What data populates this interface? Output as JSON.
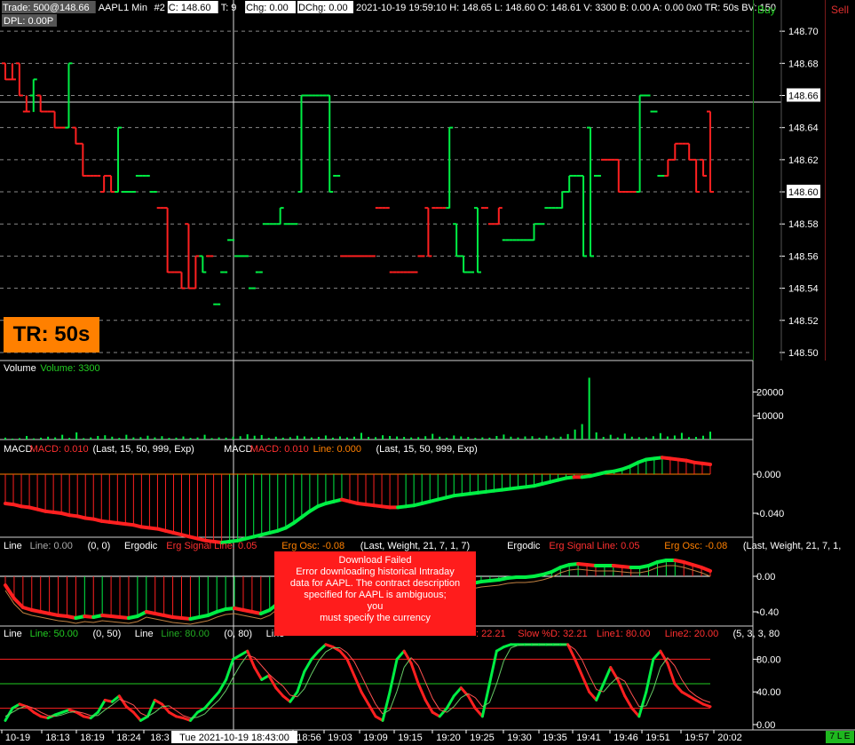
{
  "header": {
    "line1": [
      {
        "text": "Trade: 500@148.66",
        "color": "#ffffff",
        "bg": "#555555"
      },
      {
        "text": "AAPL",
        "color": "#ffffff",
        "bg": ""
      },
      {
        "text": "1 Min",
        "color": "#ffffff",
        "bg": ""
      },
      {
        "text": "#2",
        "color": "#ffffff",
        "bg": ""
      },
      {
        "text": "C: 148.60",
        "color": "#000000",
        "bg": "#ffffff"
      },
      {
        "text": "T: 9",
        "color": "#ffffff",
        "bg": ""
      },
      {
        "text": "Chg: 0.00",
        "color": "#000000",
        "bg": "#ffffff"
      },
      {
        "text": "DChg: 0.00",
        "color": "#000000",
        "bg": "#ffffff"
      },
      {
        "text": "2021-10-19 19:59:10 H: 148.65 L: 148.60 O: 148.61 V: 3300 B: 0.00 A: 0.00 0x0 TR: 50s BV: 150",
        "color": "#ffffff",
        "bg": ""
      }
    ],
    "line2": "DPL: 0.00P"
  },
  "buy_label": "Buy",
  "sell_label": "Sell",
  "tr_badge": "TR: 50s",
  "bottom_badge": "7 L E",
  "error": {
    "title": "Download Failed",
    "message": "Error downloading historical Intraday\ndata for AAPL.  The contract description\nspecified for AAPL is ambiguous;\nyou\nmust specify the currency"
  },
  "price_axis": [
    "148.70",
    "148.68",
    "148.66",
    "148.64",
    "148.62",
    "148.60",
    "148.58",
    "148.56",
    "148.54",
    "148.52",
    "148.50"
  ],
  "price_highlight": [
    "148.66",
    "148.60"
  ],
  "volume_axis": [
    "20000",
    "10000"
  ],
  "macd_axis": [
    "0.000",
    "-0.040"
  ],
  "ergodic_axis": [
    "0.00",
    "-0.40"
  ],
  "stoch_axis": [
    "80.00",
    "40.00",
    "0.00"
  ],
  "time_axis": {
    "labels": [
      "10-19",
      "18:13",
      "18:19",
      "18:24",
      "18:3",
      "18:56",
      "19:03",
      "19:09",
      "19:15",
      "19:20",
      "19:25",
      "19:30",
      "19:35",
      "19:41",
      "19:46",
      "19:51",
      "19:57",
      "20:02"
    ],
    "cursor_label": "Tue 2021-10-19  18:43:00"
  },
  "panels": {
    "volume": [
      {
        "text": "Volume",
        "color": "#ffffff"
      },
      {
        "text": "Volume: 3300",
        "color": "#22cc22"
      }
    ],
    "macd": [
      {
        "text": "MACD",
        "color": "#ffffff"
      },
      {
        "text": "MACD: 0.010",
        "color": "#ff3030"
      },
      {
        "text": "(Last, 15, 50, 999, Exp)",
        "color": "#ffffff"
      },
      {
        "text": "MACD",
        "color": "#ffffff"
      },
      {
        "text": "MACD: 0.010",
        "color": "#ff3030"
      },
      {
        "text": "Line: 0.000",
        "color": "#ff8000"
      },
      {
        "text": "(Last, 15, 50, 999, Exp)",
        "color": "#ffffff"
      }
    ],
    "ergodic": [
      {
        "text": "Line",
        "color": "#ffffff"
      },
      {
        "text": "Line: 0.00",
        "color": "#aaaaaa"
      },
      {
        "text": "(0, 0)",
        "color": "#ffffff"
      },
      {
        "text": "Ergodic",
        "color": "#ffffff"
      },
      {
        "text": "Erg Signal Line: 0.05",
        "color": "#ff3030"
      },
      {
        "text": "Erg Osc: -0.08",
        "color": "#ff8000"
      },
      {
        "text": "(Last, Weight, 21, 7, 1, 7)",
        "color": "#ffffff"
      },
      {
        "text": "Ergodic",
        "color": "#ffffff"
      },
      {
        "text": "Erg Signal Line: 0.05",
        "color": "#ff3030"
      },
      {
        "text": "Erg Osc: -0.08",
        "color": "#ff8000"
      },
      {
        "text": "(Last, Weight, 21, 7, 1,",
        "color": "#ffffff"
      }
    ],
    "stoch_left": [
      {
        "text": "Line",
        "color": "#ffffff"
      },
      {
        "text": "Line: 50.00",
        "color": "#22cc22"
      },
      {
        "text": "(0, 50)",
        "color": "#ffffff"
      },
      {
        "text": "Line",
        "color": "#ffffff"
      },
      {
        "text": "Line: 80.00",
        "color": "#22aa22"
      },
      {
        "text": "(0, 80)",
        "color": "#ffffff"
      },
      {
        "text": "Line",
        "color": "#ffffff"
      }
    ],
    "stoch_right": [
      {
        "text": ": 22.21",
        "color": "#ff3030"
      },
      {
        "text": "Slow %D: 32.21",
        "color": "#ff3030"
      },
      {
        "text": "Line1: 80.00",
        "color": "#ff3030"
      },
      {
        "text": "Line2: 20.00",
        "color": "#ff3030"
      },
      {
        "text": "(5, 3, 3, 80",
        "color": "#ffffff"
      }
    ]
  },
  "colors": {
    "up": "#00ee44",
    "down": "#ff2020",
    "grid": "#888888",
    "accent": "#ff8000"
  },
  "price_bars": [
    [
      148.68,
      148.68,
      148.68,
      148.67,
      0
    ],
    [
      148.67,
      148.67,
      148.68,
      148.67,
      0
    ],
    [
      148.68,
      148.68,
      148.66,
      148.66,
      0
    ],
    [
      148.65,
      148.65,
      148.66,
      148.65,
      0
    ],
    [
      148.66,
      148.65,
      148.67,
      148.67,
      1
    ],
    [
      148.66,
      148.66,
      148.65,
      148.65,
      0
    ],
    [
      148.65,
      148.65,
      148.65,
      148.65,
      0
    ],
    [
      148.65,
      148.64,
      148.65,
      148.64,
      0
    ],
    [
      148.64,
      148.64,
      148.64,
      148.64,
      0
    ],
    [
      148.64,
      148.64,
      148.68,
      148.68,
      1
    ],
    [
      148.64,
      148.64,
      148.63,
      148.63,
      0
    ],
    [
      148.63,
      148.63,
      148.61,
      148.61,
      0
    ],
    [
      148.61,
      148.61,
      148.61,
      148.61,
      0
    ],
    [
      148.61,
      148.61,
      148.61,
      148.61,
      0
    ],
    [
      148.6,
      148.6,
      148.61,
      148.61,
      0
    ],
    [
      148.61,
      148.61,
      148.6,
      148.6,
      0
    ],
    [
      148.6,
      148.6,
      148.64,
      148.64,
      1
    ],
    [
      148.6,
      148.6,
      148.6,
      148.6,
      1
    ],
    [
      148.6,
      148.6,
      148.6,
      148.6,
      1
    ],
    [
      148.61,
      148.61,
      148.61,
      148.61,
      1
    ],
    [
      148.61,
      148.61,
      148.61,
      148.61,
      1
    ],
    [
      148.6,
      148.6,
      148.6,
      148.6,
      1
    ],
    [
      148.59,
      148.59,
      148.59,
      148.59,
      0
    ],
    [
      148.59,
      148.59,
      148.55,
      148.55,
      0
    ],
    [
      148.55,
      148.55,
      148.55,
      148.55,
      0
    ],
    [
      148.55,
      148.55,
      148.54,
      148.54,
      0
    ],
    [
      148.58,
      148.58,
      148.54,
      148.54,
      0
    ],
    [
      148.54,
      148.54,
      148.56,
      148.56,
      0
    ],
    [
      148.56,
      148.56,
      148.55,
      148.55,
      1
    ],
    [
      148.56,
      148.56,
      148.56,
      148.56,
      0
    ],
    [
      148.53,
      148.53,
      148.53,
      148.53,
      1
    ],
    [
      148.55,
      148.55,
      148.55,
      148.55,
      1
    ],
    [
      148.57,
      148.57,
      148.57,
      148.57,
      1
    ],
    [
      148.56,
      148.56,
      148.56,
      148.56,
      1
    ],
    [
      148.56,
      148.56,
      148.56,
      148.56,
      1
    ],
    [
      148.54,
      148.54,
      148.54,
      148.54,
      1
    ],
    [
      148.55,
      148.55,
      148.55,
      148.55,
      1
    ],
    [
      148.58,
      148.58,
      148.58,
      148.58,
      1
    ],
    [
      148.58,
      148.58,
      148.58,
      148.58,
      1
    ],
    [
      148.58,
      148.58,
      148.59,
      148.59,
      1
    ],
    [
      148.58,
      148.58,
      148.58,
      148.58,
      1
    ],
    [
      148.58,
      148.58,
      148.58,
      148.58,
      1
    ],
    [
      148.6,
      148.6,
      148.66,
      148.66,
      1
    ],
    [
      148.66,
      148.66,
      148.66,
      148.66,
      1
    ],
    [
      148.66,
      148.66,
      148.66,
      148.66,
      1
    ],
    [
      148.66,
      148.66,
      148.66,
      148.66,
      1
    ],
    [
      148.66,
      148.66,
      148.6,
      148.6,
      1
    ],
    [
      148.61,
      148.61,
      148.61,
      148.61,
      1
    ],
    [
      148.56,
      148.56,
      148.56,
      148.56,
      0
    ],
    [
      148.56,
      148.56,
      148.56,
      148.56,
      0
    ],
    [
      148.56,
      148.56,
      148.56,
      148.56,
      0
    ],
    [
      148.56,
      148.56,
      148.56,
      148.56,
      0
    ],
    [
      148.56,
      148.56,
      148.56,
      148.56,
      0
    ],
    [
      148.59,
      148.59,
      148.59,
      148.59,
      0
    ],
    [
      148.59,
      148.59,
      148.59,
      148.59,
      0
    ],
    [
      148.55,
      148.55,
      148.55,
      148.55,
      0
    ],
    [
      148.55,
      148.55,
      148.55,
      148.55,
      0
    ],
    [
      148.55,
      148.55,
      148.55,
      148.55,
      0
    ],
    [
      148.55,
      148.55,
      148.55,
      148.55,
      0
    ],
    [
      148.56,
      148.56,
      148.56,
      148.56,
      0
    ],
    [
      148.59,
      148.59,
      148.56,
      148.56,
      0
    ],
    [
      148.59,
      148.59,
      148.59,
      148.59,
      0
    ],
    [
      148.59,
      148.59,
      148.59,
      148.59,
      0
    ],
    [
      148.59,
      148.59,
      148.64,
      148.64,
      1
    ],
    [
      148.58,
      148.58,
      148.56,
      148.56,
      1
    ],
    [
      148.56,
      148.56,
      148.55,
      148.55,
      1
    ],
    [
      148.55,
      148.55,
      148.55,
      148.55,
      1
    ],
    [
      148.59,
      148.59,
      148.55,
      148.55,
      1
    ],
    [
      148.59,
      148.59,
      148.59,
      148.59,
      0
    ],
    [
      148.58,
      148.58,
      148.58,
      148.58,
      0
    ],
    [
      148.58,
      148.58,
      148.59,
      148.59,
      0
    ],
    [
      148.57,
      148.57,
      148.57,
      148.57,
      1
    ],
    [
      148.57,
      148.57,
      148.57,
      148.57,
      1
    ],
    [
      148.57,
      148.57,
      148.57,
      148.57,
      1
    ],
    [
      148.57,
      148.57,
      148.57,
      148.57,
      1
    ],
    [
      148.57,
      148.57,
      148.58,
      148.58,
      1
    ],
    [
      148.58,
      148.58,
      148.58,
      148.58,
      1
    ],
    [
      148.59,
      148.59,
      148.59,
      148.59,
      1
    ],
    [
      148.59,
      148.59,
      148.59,
      148.59,
      1
    ],
    [
      148.59,
      148.59,
      148.6,
      148.6,
      1
    ],
    [
      148.6,
      148.6,
      148.61,
      148.61,
      1
    ],
    [
      148.61,
      148.61,
      148.61,
      148.61,
      1
    ],
    [
      148.61,
      148.61,
      148.56,
      148.56,
      1
    ],
    [
      148.64,
      148.64,
      148.56,
      148.56,
      1
    ],
    [
      148.61,
      148.61,
      148.61,
      148.61,
      1
    ],
    [
      148.62,
      148.62,
      148.62,
      148.62,
      0
    ],
    [
      148.62,
      148.62,
      148.62,
      148.62,
      0
    ],
    [
      148.62,
      148.62,
      148.6,
      148.6,
      0
    ],
    [
      148.6,
      148.6,
      148.6,
      148.6,
      0
    ],
    [
      148.6,
      148.6,
      148.6,
      148.6,
      0
    ],
    [
      148.6,
      148.6,
      148.66,
      148.66,
      1
    ],
    [
      148.66,
      148.66,
      148.66,
      148.66,
      1
    ],
    [
      148.65,
      148.65,
      148.65,
      148.65,
      1
    ],
    [
      148.61,
      148.61,
      148.61,
      148.61,
      1
    ],
    [
      148.61,
      148.61,
      148.62,
      148.62,
      0
    ],
    [
      148.62,
      148.62,
      148.63,
      148.63,
      0
    ],
    [
      148.63,
      148.63,
      148.63,
      148.63,
      0
    ],
    [
      148.63,
      148.63,
      148.62,
      148.62,
      0
    ],
    [
      148.62,
      148.62,
      148.6,
      148.6,
      0
    ],
    [
      148.62,
      148.62,
      148.61,
      148.61,
      0
    ],
    [
      148.65,
      148.65,
      148.6,
      148.6,
      0
    ]
  ],
  "volumes": [
    800,
    400,
    600,
    1500,
    500,
    800,
    1200,
    900,
    2000,
    700,
    3000,
    600,
    900,
    1500,
    1800,
    1200,
    700,
    2000,
    900,
    1000,
    1600,
    900,
    1400,
    700,
    800,
    1300,
    700,
    900,
    2000,
    600,
    900,
    800,
    1200,
    1400,
    2200,
    1600,
    1900,
    700,
    1200,
    800,
    1000,
    1600,
    1300,
    900,
    1100,
    1700,
    800,
    1300,
    900,
    1200,
    2800,
    1100,
    1000,
    1800,
    1500,
    1300,
    1100,
    900,
    1000,
    1400,
    2400,
    1200,
    800,
    1700,
    1300,
    1100,
    700,
    900,
    800,
    1500,
    2100,
    1200,
    900,
    1300,
    1400,
    800,
    1600,
    900,
    1200,
    2300,
    4200,
    6500,
    26000,
    3000,
    1100,
    2000,
    900,
    2500,
    1200,
    1000,
    900,
    1400,
    2700,
    1300,
    1700,
    2800,
    1000,
    1100,
    1600,
    3300
  ],
  "macd_hist": [
    -0.03,
    -0.031,
    -0.033,
    -0.034,
    -0.036,
    -0.038,
    -0.039,
    -0.04,
    -0.042,
    -0.043,
    -0.045,
    -0.046,
    -0.048,
    -0.049,
    -0.05,
    -0.051,
    -0.052,
    -0.054,
    -0.055,
    -0.056,
    -0.058,
    -0.06,
    -0.062,
    -0.064,
    -0.066,
    -0.068,
    -0.069,
    -0.07,
    -0.069,
    -0.068,
    -0.066,
    -0.064,
    -0.062,
    -0.06,
    -0.058,
    -0.055,
    -0.05,
    -0.044,
    -0.038,
    -0.033,
    -0.03,
    -0.028,
    -0.026,
    -0.028,
    -0.03,
    -0.031,
    -0.032,
    -0.033,
    -0.034,
    -0.034,
    -0.033,
    -0.032,
    -0.03,
    -0.028,
    -0.026,
    -0.024,
    -0.022,
    -0.021,
    -0.02,
    -0.019,
    -0.018,
    -0.017,
    -0.016,
    -0.015,
    -0.014,
    -0.013,
    -0.012,
    -0.01,
    -0.008,
    -0.006,
    -0.004,
    -0.003,
    -0.003,
    -0.002,
    0.0,
    0.002,
    0.003,
    0.005,
    0.008,
    0.012,
    0.015,
    0.016,
    0.017,
    0.016,
    0.015,
    0.014,
    0.012,
    0.011,
    0.01
  ],
  "ergodic_hist": [
    -0.1,
    -0.25,
    -0.35,
    -0.38,
    -0.4,
    -0.42,
    -0.44,
    -0.45,
    -0.47,
    -0.45,
    -0.46,
    -0.44,
    -0.45,
    -0.46,
    -0.47,
    -0.45,
    -0.4,
    -0.42,
    -0.44,
    -0.46,
    -0.47,
    -0.48,
    -0.46,
    -0.44,
    -0.4,
    -0.37,
    -0.36,
    -0.38,
    -0.4,
    -0.42,
    -0.38,
    -0.3,
    -0.26,
    -0.2,
    -0.1,
    -0.02,
    0.05,
    0.1,
    0.1,
    0.08,
    0.04,
    0.0,
    -0.05,
    -0.08,
    -0.1,
    -0.12,
    -0.14,
    -0.16,
    -0.18,
    -0.16,
    -0.12,
    -0.1,
    -0.09,
    -0.08,
    -0.06,
    -0.05,
    -0.04,
    -0.02,
    -0.01,
    -0.01,
    0.0,
    0.02,
    0.05,
    0.1,
    0.13,
    0.14,
    0.13,
    0.12,
    0.12,
    0.12,
    0.11,
    0.1,
    0.1,
    0.12,
    0.16,
    0.18,
    0.18,
    0.16,
    0.13,
    0.1,
    0.06
  ],
  "stoch_k": [
    5,
    20,
    25,
    22,
    15,
    10,
    8,
    12,
    15,
    18,
    15,
    10,
    8,
    15,
    30,
    28,
    35,
    22,
    15,
    5,
    10,
    30,
    25,
    15,
    10,
    8,
    5,
    15,
    20,
    30,
    40,
    55,
    80,
    85,
    90,
    70,
    55,
    60,
    45,
    35,
    28,
    40,
    65,
    80,
    90,
    98,
    95,
    90,
    80,
    60,
    40,
    25,
    10,
    5,
    40,
    80,
    90,
    75,
    50,
    30,
    15,
    10,
    20,
    35,
    45,
    35,
    20,
    10,
    50,
    90,
    95,
    98,
    98,
    98,
    98,
    98,
    98,
    98,
    98,
    98,
    80,
    60,
    40,
    30,
    50,
    70,
    55,
    35,
    20,
    10,
    40,
    80,
    90,
    75,
    50,
    40,
    35,
    30,
    25,
    22
  ],
  "stoch_d": [
    10,
    15,
    20,
    23,
    20,
    15,
    11,
    10,
    12,
    15,
    16,
    14,
    11,
    11,
    18,
    24,
    31,
    28,
    24,
    14,
    10,
    15,
    22,
    23,
    17,
    11,
    8,
    9,
    13,
    22,
    30,
    42,
    58,
    73,
    85,
    82,
    72,
    62,
    54,
    47,
    36,
    34,
    44,
    62,
    78,
    89,
    94,
    94,
    88,
    77,
    60,
    42,
    25,
    13,
    18,
    41,
    70,
    82,
    72,
    52,
    32,
    18,
    15,
    22,
    33,
    38,
    33,
    22,
    27,
    50,
    78,
    94,
    97,
    98,
    98,
    98,
    98,
    98,
    98,
    98,
    92,
    79,
    60,
    43,
    40,
    50,
    58,
    53,
    37,
    22,
    23,
    43,
    70,
    82,
    72,
    55,
    42,
    35,
    30,
    27
  ]
}
